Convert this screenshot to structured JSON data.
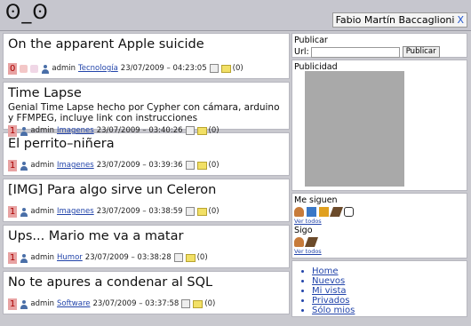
{
  "header": {
    "logo": "ʘ_ʘ",
    "username": "Fabio Martín Baccaglioni",
    "close": "X"
  },
  "posts": [
    {
      "title": "On the apparent Apple suicide",
      "desc": "",
      "score": "0",
      "author": "admin",
      "category": "Tecnología",
      "date": "23/07/2009 – 04:23:05",
      "comments": "(0)",
      "votes": true
    },
    {
      "title": "Time Lapse",
      "desc": "Genial Time Lapse hecho por Cypher con cámara, arduino y FFMPEG, incluye link con instrucciones",
      "score": "1",
      "author": "admin",
      "category": "Imagenes",
      "date": "23/07/2009 – 03:40:26",
      "comments": "(0)",
      "votes": false
    },
    {
      "title": "El perrito–niñera",
      "desc": "",
      "score": "1",
      "author": "admin",
      "category": "Imagenes",
      "date": "23/07/2009 – 03:39:36",
      "comments": "(0)",
      "votes": false
    },
    {
      "title": "[IMG] Para algo sirve un Celeron",
      "desc": "",
      "score": "1",
      "author": "admin",
      "category": "Imagenes",
      "date": "23/07/2009 – 03:38:59",
      "comments": "(0)",
      "votes": false
    },
    {
      "title": "Ups... Mario me va a matar",
      "desc": "",
      "score": "1",
      "author": "admin",
      "category": "Humor",
      "date": "23/07/2009 – 03:38:28",
      "comments": "(0)",
      "votes": false
    },
    {
      "title": "No te apures a condenar al SQL",
      "desc": "",
      "score": "1",
      "author": "admin",
      "category": "Software",
      "date": "23/07/2009 – 03:37:58",
      "comments": "(0)",
      "votes": false
    }
  ],
  "sidebar": {
    "publicar_title": "Publicar",
    "url_label": "Url:",
    "url_value": "",
    "publicar_button": "Publicar",
    "publicidad_title": "Publicidad",
    "me_siguen_title": "Me siguen",
    "sigo_title": "Sigo",
    "ver_todos": "Ver todos",
    "menu": [
      "Home",
      "Nuevos",
      "Mi vista",
      "Privados",
      "Sólo mios"
    ]
  },
  "colors": {
    "background": "#c9c9cf",
    "link": "#2244aa",
    "score_bg": "#e8a3a3",
    "ad_placeholder": "#a9a9a9"
  }
}
